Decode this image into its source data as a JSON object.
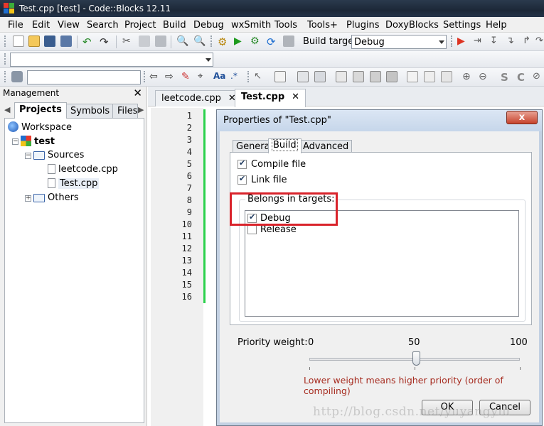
{
  "window": {
    "title": "Test.cpp [test] - Code::Blocks 12.11"
  },
  "menu": [
    "File",
    "Edit",
    "View",
    "Search",
    "Project",
    "Build",
    "Debug",
    "wxSmith",
    "Tools",
    "Tools+",
    "Plugins",
    "DoxyBlocks",
    "Settings",
    "Help"
  ],
  "toolbar": {
    "build_target_label": "Build target:",
    "build_target_value": "Debug"
  },
  "management": {
    "header": "Management",
    "close": "✕",
    "tabs": [
      "Projects",
      "Symbols",
      "Files"
    ],
    "tree": {
      "workspace": "Workspace",
      "project": "test",
      "sources": "Sources",
      "file1": "leetcode.cpp",
      "file2": "Test.cpp",
      "others": "Others"
    }
  },
  "editor": {
    "tabs": [
      {
        "label": "leetcode.cpp",
        "close": "✕"
      },
      {
        "label": "Test.cpp",
        "close": "✕"
      }
    ],
    "line_numbers": [
      "1",
      "2",
      "3",
      "4",
      "5",
      "6",
      "7",
      "8",
      "9",
      "10",
      "11",
      "12",
      "13",
      "14",
      "15",
      "16"
    ]
  },
  "dialog": {
    "title": "Properties of \"Test.cpp\"",
    "close": "x",
    "tabs": [
      "General",
      "Build",
      "Advanced"
    ],
    "compile_file": {
      "label": "Compile file",
      "checked": true
    },
    "link_file": {
      "label": "Link file",
      "checked": true
    },
    "belongs_title": "Belongs in targets:",
    "targets": [
      {
        "label": "Debug",
        "checked": true
      },
      {
        "label": "Release",
        "checked": false
      }
    ],
    "priority": {
      "label": "Priority weight:",
      "min": "0",
      "mid": "50",
      "max": "100",
      "value": 50
    },
    "hint": "Lower weight means higher priority (order of compiling)",
    "ok": "OK",
    "cancel": "Cancel"
  },
  "watermark": "http://blog.csdn.net/yuyangyiu"
}
